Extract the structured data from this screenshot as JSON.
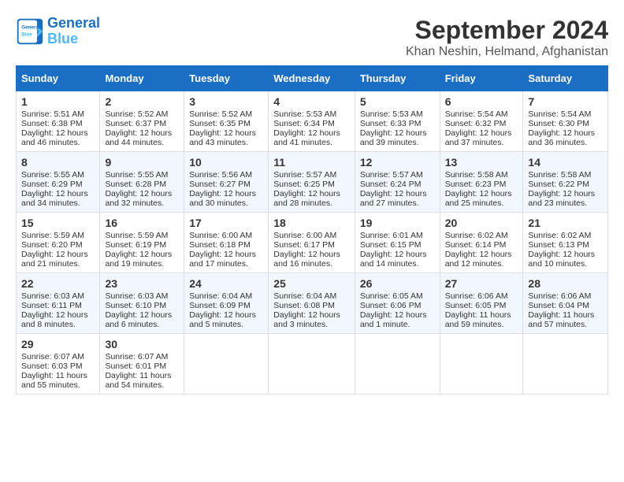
{
  "app": {
    "name_line1": "General",
    "name_line2": "Blue"
  },
  "calendar": {
    "title": "September 2024",
    "subtitle": "Khan Neshin, Helmand, Afghanistan",
    "headers": [
      "Sunday",
      "Monday",
      "Tuesday",
      "Wednesday",
      "Thursday",
      "Friday",
      "Saturday"
    ],
    "rows": [
      [
        {
          "day": "1",
          "info": "Sunrise: 5:51 AM\nSunset: 6:38 PM\nDaylight: 12 hours\nand 46 minutes."
        },
        {
          "day": "2",
          "info": "Sunrise: 5:52 AM\nSunset: 6:37 PM\nDaylight: 12 hours\nand 44 minutes."
        },
        {
          "day": "3",
          "info": "Sunrise: 5:52 AM\nSunset: 6:35 PM\nDaylight: 12 hours\nand 43 minutes."
        },
        {
          "day": "4",
          "info": "Sunrise: 5:53 AM\nSunset: 6:34 PM\nDaylight: 12 hours\nand 41 minutes."
        },
        {
          "day": "5",
          "info": "Sunrise: 5:53 AM\nSunset: 6:33 PM\nDaylight: 12 hours\nand 39 minutes."
        },
        {
          "day": "6",
          "info": "Sunrise: 5:54 AM\nSunset: 6:32 PM\nDaylight: 12 hours\nand 37 minutes."
        },
        {
          "day": "7",
          "info": "Sunrise: 5:54 AM\nSunset: 6:30 PM\nDaylight: 12 hours\nand 36 minutes."
        }
      ],
      [
        {
          "day": "8",
          "info": "Sunrise: 5:55 AM\nSunset: 6:29 PM\nDaylight: 12 hours\nand 34 minutes."
        },
        {
          "day": "9",
          "info": "Sunrise: 5:55 AM\nSunset: 6:28 PM\nDaylight: 12 hours\nand 32 minutes."
        },
        {
          "day": "10",
          "info": "Sunrise: 5:56 AM\nSunset: 6:27 PM\nDaylight: 12 hours\nand 30 minutes."
        },
        {
          "day": "11",
          "info": "Sunrise: 5:57 AM\nSunset: 6:25 PM\nDaylight: 12 hours\nand 28 minutes."
        },
        {
          "day": "12",
          "info": "Sunrise: 5:57 AM\nSunset: 6:24 PM\nDaylight: 12 hours\nand 27 minutes."
        },
        {
          "day": "13",
          "info": "Sunrise: 5:58 AM\nSunset: 6:23 PM\nDaylight: 12 hours\nand 25 minutes."
        },
        {
          "day": "14",
          "info": "Sunrise: 5:58 AM\nSunset: 6:22 PM\nDaylight: 12 hours\nand 23 minutes."
        }
      ],
      [
        {
          "day": "15",
          "info": "Sunrise: 5:59 AM\nSunset: 6:20 PM\nDaylight: 12 hours\nand 21 minutes."
        },
        {
          "day": "16",
          "info": "Sunrise: 5:59 AM\nSunset: 6:19 PM\nDaylight: 12 hours\nand 19 minutes."
        },
        {
          "day": "17",
          "info": "Sunrise: 6:00 AM\nSunset: 6:18 PM\nDaylight: 12 hours\nand 17 minutes."
        },
        {
          "day": "18",
          "info": "Sunrise: 6:00 AM\nSunset: 6:17 PM\nDaylight: 12 hours\nand 16 minutes."
        },
        {
          "day": "19",
          "info": "Sunrise: 6:01 AM\nSunset: 6:15 PM\nDaylight: 12 hours\nand 14 minutes."
        },
        {
          "day": "20",
          "info": "Sunrise: 6:02 AM\nSunset: 6:14 PM\nDaylight: 12 hours\nand 12 minutes."
        },
        {
          "day": "21",
          "info": "Sunrise: 6:02 AM\nSunset: 6:13 PM\nDaylight: 12 hours\nand 10 minutes."
        }
      ],
      [
        {
          "day": "22",
          "info": "Sunrise: 6:03 AM\nSunset: 6:11 PM\nDaylight: 12 hours\nand 8 minutes."
        },
        {
          "day": "23",
          "info": "Sunrise: 6:03 AM\nSunset: 6:10 PM\nDaylight: 12 hours\nand 6 minutes."
        },
        {
          "day": "24",
          "info": "Sunrise: 6:04 AM\nSunset: 6:09 PM\nDaylight: 12 hours\nand 5 minutes."
        },
        {
          "day": "25",
          "info": "Sunrise: 6:04 AM\nSunset: 6:08 PM\nDaylight: 12 hours\nand 3 minutes."
        },
        {
          "day": "26",
          "info": "Sunrise: 6:05 AM\nSunset: 6:06 PM\nDaylight: 12 hours\nand 1 minute."
        },
        {
          "day": "27",
          "info": "Sunrise: 6:06 AM\nSunset: 6:05 PM\nDaylight: 11 hours\nand 59 minutes."
        },
        {
          "day": "28",
          "info": "Sunrise: 6:06 AM\nSunset: 6:04 PM\nDaylight: 11 hours\nand 57 minutes."
        }
      ],
      [
        {
          "day": "29",
          "info": "Sunrise: 6:07 AM\nSunset: 6:03 PM\nDaylight: 11 hours\nand 55 minutes."
        },
        {
          "day": "30",
          "info": "Sunrise: 6:07 AM\nSunset: 6:01 PM\nDaylight: 11 hours\nand 54 minutes."
        },
        null,
        null,
        null,
        null,
        null
      ]
    ]
  }
}
